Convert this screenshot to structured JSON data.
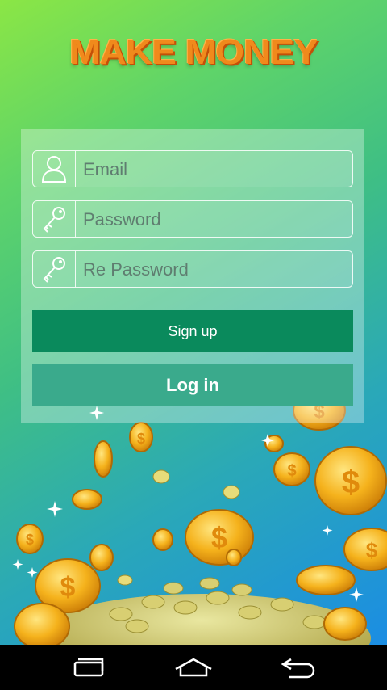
{
  "app": {
    "title": "MAKE MONEY"
  },
  "form": {
    "email": {
      "placeholder": "Email",
      "value": ""
    },
    "password": {
      "placeholder": "Password",
      "value": ""
    },
    "re_password": {
      "placeholder": "Re Password",
      "value": ""
    },
    "signup_label": "Sign up",
    "login_label": "Log in"
  },
  "icons": {
    "user": "user-icon",
    "key": "key-icon",
    "nav_recent": "recent-apps-icon",
    "nav_home": "home-icon",
    "nav_back": "back-icon"
  },
  "colors": {
    "title": "#f08a1c",
    "signup_button": "#0a8a5c",
    "login_button": "#3aaa8c",
    "coin": "#f5b21c"
  }
}
